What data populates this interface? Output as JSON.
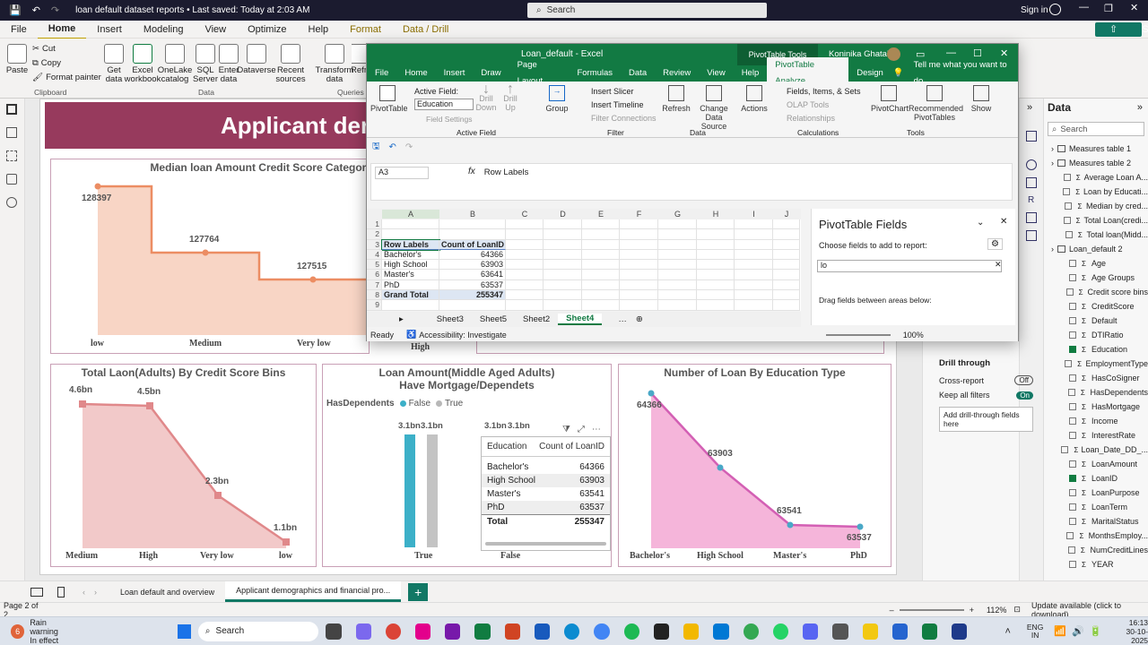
{
  "pbi": {
    "title": "loan default dataset reports • Last saved: Today at 2:03 AM",
    "search": "Search",
    "signin": "Sign in",
    "share": "Share",
    "menu": [
      "File",
      "Home",
      "Insert",
      "Modeling",
      "View",
      "Optimize",
      "Help",
      "Format",
      "Data / Drill"
    ],
    "ribbon": [
      {
        "l": "Paste"
      },
      {
        "l": "Cut"
      },
      {
        "l": "Copy"
      },
      {
        "l": "Format painter"
      },
      {
        "l": "Get data"
      },
      {
        "l": "Excel workbook"
      },
      {
        "l": "OneLake catalog"
      },
      {
        "l": "SQL Server"
      },
      {
        "l": "Enter data"
      },
      {
        "l": "Dataverse"
      },
      {
        "l": "Recent sources"
      },
      {
        "l": "Transform data"
      },
      {
        "l": "Refr"
      }
    ],
    "groups": {
      "clipboard": "Clipboard",
      "data": "Data",
      "queries": "Queries"
    },
    "report_title": "Applicant der",
    "pages": [
      "Loan default and overview",
      "Applicant demographics and financial pro..."
    ],
    "status_page": "Page 2 of 2",
    "zoom": "112%",
    "update": "Update available (click to download)"
  },
  "charts": {
    "c1": {
      "title": "Median loan Amount Credit Score Category",
      "labels": [
        "128397",
        "127764",
        "127515"
      ],
      "x": [
        "low",
        "Medium",
        "Very low",
        "High"
      ]
    },
    "c2": {
      "title": "Total Laon(Adults) By Credit Score Bins",
      "labels": [
        "4.6bn",
        "4.5bn",
        "2.3bn",
        "1.1bn"
      ],
      "x": [
        "Medium",
        "High",
        "Very low",
        "low"
      ]
    },
    "c3": {
      "title": "Loan Amount(Middle Aged Adults) Have Mortgage/Dependets",
      "legend_title": "HasDependents",
      "legend": [
        "False",
        "True"
      ],
      "labels": [
        "3.1bn",
        "3.1bn",
        "3.1bn",
        "3.1bn"
      ],
      "x": [
        "True",
        "False"
      ]
    },
    "c4": {
      "title": "Number of Loan By Education Type",
      "labels": [
        "64366",
        "63903",
        "63541",
        "63537"
      ],
      "x": [
        "Bachelor's",
        "High School",
        "Master's",
        "PhD"
      ]
    },
    "table": {
      "h1": "Education",
      "h2": "Count of LoanID",
      "rows": [
        [
          "Bachelor's",
          "64366"
        ],
        [
          "High School",
          "63903"
        ],
        [
          "Master's",
          "63541"
        ],
        [
          "PhD",
          "63537"
        ]
      ],
      "total": [
        "Total",
        "255347"
      ]
    }
  },
  "chart_data": [
    {
      "type": "line",
      "title": "Median loan Amount Credit Score Category",
      "categories": [
        "low",
        "Medium",
        "Very low",
        "High"
      ],
      "values": [
        128397,
        127764,
        127515,
        null
      ]
    },
    {
      "type": "area",
      "title": "Total Laon(Adults) By Credit Score Bins",
      "categories": [
        "Medium",
        "High",
        "Very low",
        "low"
      ],
      "values": [
        4.6,
        4.5,
        2.3,
        1.1
      ]
    },
    {
      "type": "bar",
      "title": "Loan Amount(Middle Aged Adults) Have Mortgage/Dependets",
      "categories": [
        "True",
        "False"
      ],
      "series": [
        {
          "name": "False",
          "values": [
            3.1,
            3.1
          ]
        },
        {
          "name": "True",
          "values": [
            3.1,
            3.1
          ]
        }
      ]
    },
    {
      "type": "area",
      "title": "Number of Loan By Education Type",
      "categories": [
        "Bachelor's",
        "High School",
        "Master's",
        "PhD"
      ],
      "values": [
        64366,
        63903,
        63541,
        63537
      ]
    }
  ],
  "excel": {
    "title": "Loan_default - Excel",
    "tools": "PivotTable Tools",
    "user": "Koninika Ghatak",
    "tabs": [
      "File",
      "Home",
      "Insert",
      "Draw",
      "Page Layout",
      "Formulas",
      "Data",
      "Review",
      "View",
      "Help",
      "PivotTable Analyze",
      "Design"
    ],
    "tell": "Tell me what you want to do",
    "active_field_label": "Active Field:",
    "active_field": "Education",
    "field_settings": "Field Settings",
    "rib": [
      "PivotTable",
      "Drill Down",
      "Drill Up",
      "Group",
      "Insert Slicer",
      "Insert Timeline",
      "Filter Connections",
      "Refresh",
      "Change Data Source",
      "Actions",
      "Fields, Items, & Sets",
      "OLAP Tools",
      "Relationships",
      "PivotChart",
      "Recommended PivotTables",
      "Show"
    ],
    "rgroups": [
      "Active Field",
      "Filter",
      "Data",
      "Calculations",
      "Tools"
    ],
    "namebox": "A3",
    "formula": "Row Labels",
    "cols": [
      "A",
      "B",
      "C",
      "D",
      "E",
      "F",
      "G",
      "H",
      "I",
      "J"
    ],
    "rows": [
      [
        "",
        ""
      ],
      [
        "",
        ""
      ],
      [
        "Row Labels",
        "Count of LoanID"
      ],
      [
        "Bachelor's",
        "64366"
      ],
      [
        "High School",
        "63903"
      ],
      [
        "Master's",
        "63641"
      ],
      [
        "PhD",
        "63537"
      ],
      [
        "Grand Total",
        "255347"
      ],
      [
        "",
        ""
      ]
    ],
    "sheets": [
      "Sheet3",
      "Sheet5",
      "Sheet2",
      "Sheet4"
    ],
    "status": "Ready",
    "access": "Accessibility: Investigate",
    "zoom": "100%",
    "pf_title": "PivotTable Fields",
    "pf_sub": "Choose fields to add to report:",
    "pf_search": "lo",
    "pf_drag": "Drag fields between areas below:"
  },
  "right": {
    "title": "Data",
    "search": "Search",
    "fields": [
      {
        "n": "Measures table 1",
        "c": false,
        "t": "tbl"
      },
      {
        "n": "Measures table 2",
        "c": false,
        "t": "tbl"
      },
      {
        "n": "Average Loan A...",
        "c": false
      },
      {
        "n": "Loan by Educati...",
        "c": false
      },
      {
        "n": "Median by cred...",
        "c": false
      },
      {
        "n": "Total Loan(credi...",
        "c": false
      },
      {
        "n": "Total loan(Midd...",
        "c": false
      },
      {
        "n": "Loan_default 2",
        "c": false,
        "t": "tbl"
      },
      {
        "n": "Age",
        "c": false
      },
      {
        "n": "Age Groups",
        "c": false
      },
      {
        "n": "Credit score bins",
        "c": false
      },
      {
        "n": "CreditScore",
        "c": false
      },
      {
        "n": "Default",
        "c": false
      },
      {
        "n": "DTIRatio",
        "c": false
      },
      {
        "n": "Education",
        "c": true
      },
      {
        "n": "EmploymentType",
        "c": false
      },
      {
        "n": "HasCoSigner",
        "c": false
      },
      {
        "n": "HasDependents",
        "c": false
      },
      {
        "n": "HasMortgage",
        "c": false
      },
      {
        "n": "Income",
        "c": false
      },
      {
        "n": "InterestRate",
        "c": false
      },
      {
        "n": "Loan_Date_DD_...",
        "c": false
      },
      {
        "n": "LoanAmount",
        "c": false
      },
      {
        "n": "LoanID",
        "c": true
      },
      {
        "n": "LoanPurpose",
        "c": false
      },
      {
        "n": "LoanTerm",
        "c": false
      },
      {
        "n": "MaritalStatus",
        "c": false
      },
      {
        "n": "MonthsEmploy...",
        "c": false
      },
      {
        "n": "NumCreditLines",
        "c": false
      },
      {
        "n": "YEAR",
        "c": false
      }
    ]
  },
  "drill": {
    "title": "Drill through",
    "cross": "Cross-report",
    "cross_v": "Off",
    "keep": "Keep all filters",
    "keep_v": "On",
    "add": "Add drill-through fields here"
  },
  "taskbar": {
    "weather1": "Rain warning",
    "weather2": "In effect",
    "search": "Search",
    "lang1": "ENG",
    "lang2": "IN",
    "time": "16:13",
    "date": "30-10-2025"
  }
}
